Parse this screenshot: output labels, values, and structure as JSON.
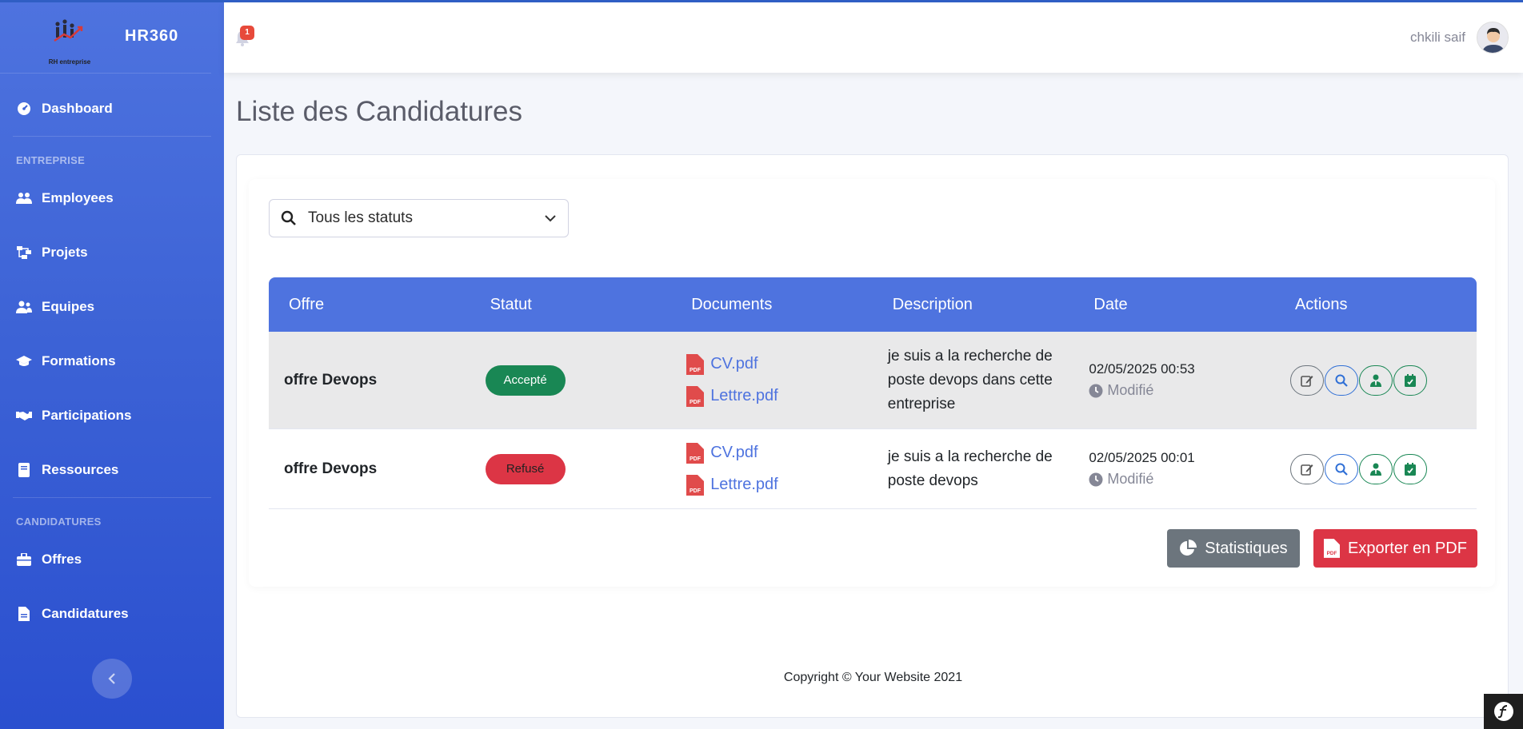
{
  "brand": {
    "name": "HR360",
    "logo_text": "RH entreprise"
  },
  "sidebar": {
    "dashboard": "Dashboard",
    "heading_entreprise": "ENTREPRISE",
    "entreprise_items": [
      {
        "label": "Employees",
        "icon": "users-icon"
      },
      {
        "label": "Projets",
        "icon": "sitemap-icon"
      },
      {
        "label": "Equipes",
        "icon": "user-friends-icon"
      },
      {
        "label": "Formations",
        "icon": "graduation-cap-icon"
      },
      {
        "label": "Participations",
        "icon": "handshake-icon"
      },
      {
        "label": "Ressources",
        "icon": "book-icon"
      }
    ],
    "heading_candidatures": "CANDIDATURES",
    "candidature_items": [
      {
        "label": "Offres",
        "icon": "briefcase-icon"
      },
      {
        "label": "Candidatures",
        "icon": "file-icon"
      }
    ]
  },
  "topbar": {
    "notification_count": "1",
    "user_name": "chkili saif"
  },
  "page": {
    "title": "Liste des Candidatures"
  },
  "filter": {
    "selected": "Tous les statuts"
  },
  "table": {
    "headers": [
      "Offre",
      "Statut",
      "Documents",
      "Description",
      "Date",
      "Actions"
    ],
    "rows": [
      {
        "offre": "offre Devops",
        "statut": "Accepté",
        "docs": [
          "CV.pdf",
          "Lettre.pdf"
        ],
        "description": "je suis a la recherche de poste devops dans cette entreprise",
        "date": "02/05/2025 00:53",
        "state": "Modifié"
      },
      {
        "offre": "offre Devops",
        "statut": "Refusé",
        "docs": [
          "CV.pdf",
          "Lettre.pdf"
        ],
        "description": "je suis a la recherche de poste devops",
        "date": "02/05/2025 00:01",
        "state": "Modifié"
      }
    ]
  },
  "buttons": {
    "stats": "Statistiques",
    "export": "Exporter en PDF"
  },
  "footer": {
    "copyright": "Copyright © Your Website 2021"
  },
  "colors": {
    "primary": "#4e73df",
    "success": "#198754",
    "danger": "#dc3545",
    "secondary": "#6c757d"
  }
}
